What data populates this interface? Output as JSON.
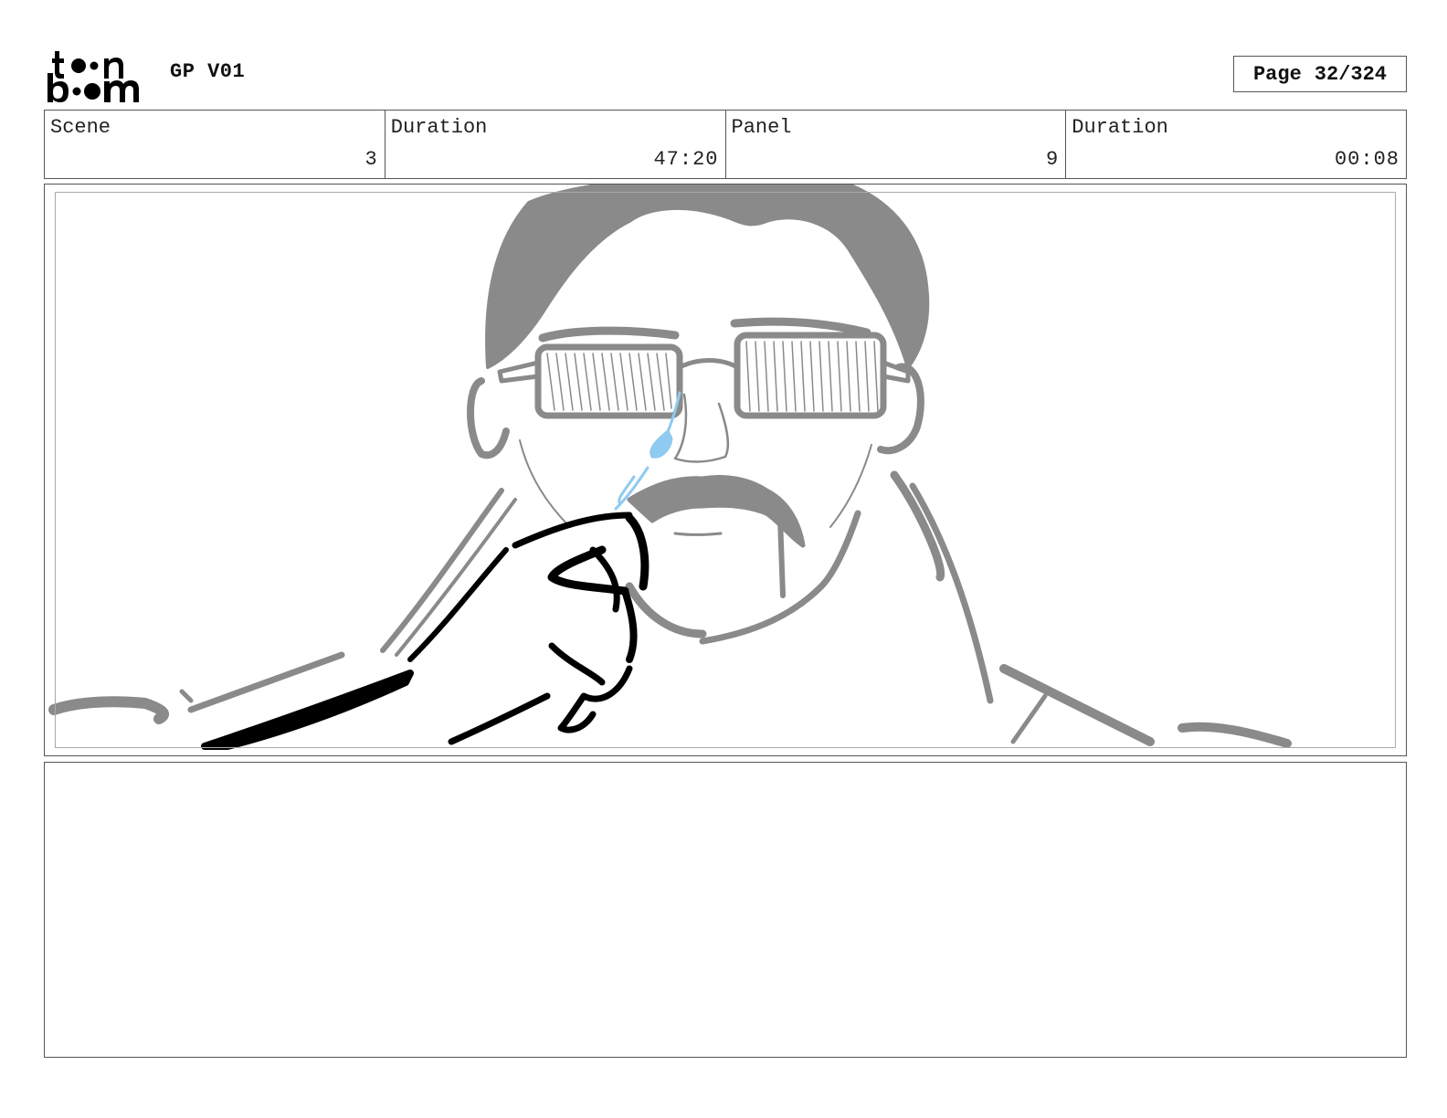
{
  "header": {
    "logo_line1": "toon",
    "logo_line2": "boom",
    "project_title": "GP V01",
    "page_label": "Page",
    "page_number": "32/324"
  },
  "info": {
    "scene_label": "Scene",
    "scene_value": "3",
    "scene_duration_label": "Duration",
    "scene_duration_value": "47:20",
    "panel_label": "Panel",
    "panel_value": "9",
    "panel_duration_label": "Duration",
    "panel_duration_value": "00:08"
  },
  "colors": {
    "sketch_gray": "#8a8a8a",
    "ink_black": "#000000",
    "tear_blue": "#8fcaf0"
  }
}
